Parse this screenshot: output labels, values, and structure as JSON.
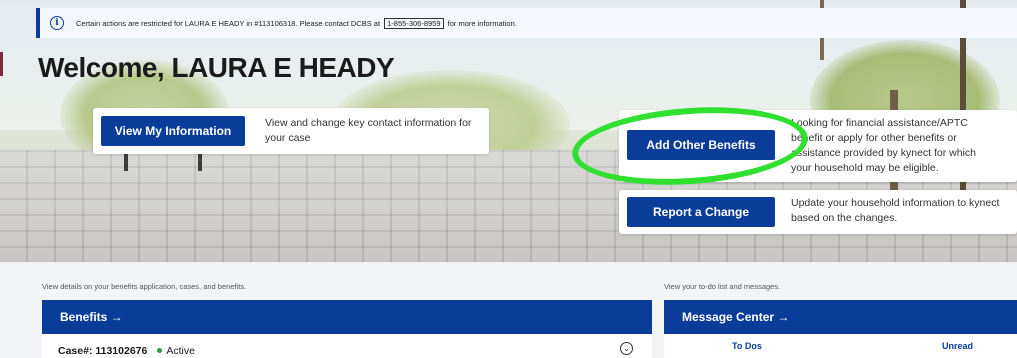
{
  "banner": {
    "text_before": "Certain actions are restricted for LAURA E HEADY in #113106318. Please contact DCBS at",
    "phone": "1-855-306-8959",
    "text_after": "for more information."
  },
  "welcome": {
    "title": "Welcome, LAURA E HEADY"
  },
  "cards": {
    "view_info": {
      "button": "View My Information",
      "description": "View and change key contact information for your case"
    },
    "add_benefits": {
      "button": "Add Other Benefits",
      "description": "Looking for financial assistance/APTC benefit or apply for other benefits or assistance provided by kynect for which your household may be eligible."
    },
    "report_change": {
      "button": "Report a Change",
      "description": "Update your household information to kynect based on the changes."
    }
  },
  "benefits_section": {
    "caption": "View details on your benefits application, cases, and benefits.",
    "header": "Benefits →",
    "case_label": "Case#: 113102676",
    "case_status": "Active"
  },
  "messages_section": {
    "caption": "View your to-do list and messages.",
    "header": "Message Center →",
    "tabs": [
      "To Dos",
      "Unread"
    ]
  },
  "colors": {
    "primary": "#0a3d99",
    "annotation": "#2fe030",
    "active": "#2e9d4e"
  }
}
